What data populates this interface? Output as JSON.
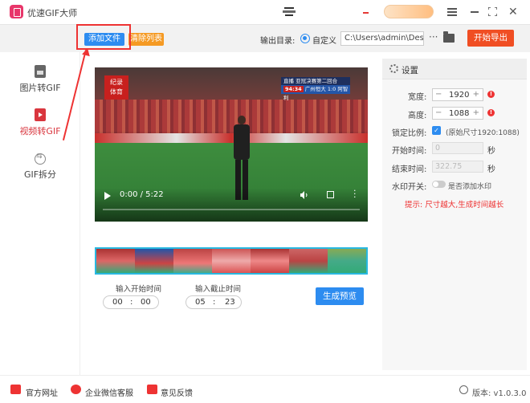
{
  "app": {
    "title": "优速GIF大师"
  },
  "toolbar": {
    "add_file": "添加文件",
    "clear_list": "清除列表",
    "output_dir_label": "输出目录:",
    "custom_label": "自定义",
    "output_path": "C:\\Users\\admin\\Deskto",
    "more": "···",
    "start_export": "开始导出"
  },
  "sidebar": {
    "items": [
      {
        "label": "图片转GIF",
        "icon": "image-file-icon",
        "active": false
      },
      {
        "label": "视频转GIF",
        "icon": "video-file-icon",
        "active": true
      },
      {
        "label": "GIF拆分",
        "icon": "split-icon",
        "active": false
      }
    ]
  },
  "video": {
    "time": "0:00 / 5:22",
    "logo_text": "纪录\n体育",
    "score_top": "直播  亚冠决赛第二回合",
    "score_time": "94:34",
    "score_text": "广州恒大 1:0 阿智利"
  },
  "trim": {
    "start_label": "输入开始时间",
    "end_label": "输入截止时间",
    "start_min": "00",
    "start_sec": "00",
    "end_min": "05",
    "end_sec": "23",
    "sep": ":",
    "preview_button": "生成预览"
  },
  "settings": {
    "title": "设置",
    "width_label": "宽度:",
    "width_value": "1920",
    "height_label": "高度:",
    "height_value": "1088",
    "lock_label": "锁定比例:",
    "lock_note": "(原始尺寸1920:1088)",
    "start_label": "开始时间:",
    "start_value": "0",
    "end_label": "结束时间:",
    "end_value": "322.75",
    "unit_sec": "秒",
    "watermark_label": "水印开关:",
    "watermark_note": "是否添加水印",
    "tip": "提示: 尺寸越大,生成时间越长"
  },
  "footer": {
    "website": "官方网址",
    "wechat": "企业微信客服",
    "feedback": "意见反馈",
    "version": "版本: v1.0.3.0"
  },
  "colors": {
    "accent_blue": "#2d8cf0",
    "export_red": "#f04e23",
    "clear_orange": "#f59a23",
    "active_red": "#d9363e"
  }
}
